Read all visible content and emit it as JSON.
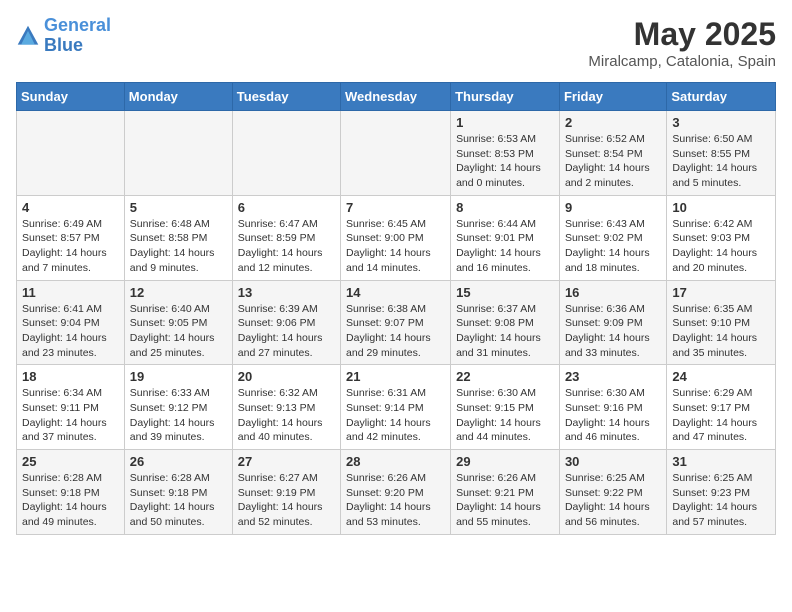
{
  "header": {
    "logo_line1": "General",
    "logo_line2": "Blue",
    "month_year": "May 2025",
    "location": "Miralcamp, Catalonia, Spain"
  },
  "days_of_week": [
    "Sunday",
    "Monday",
    "Tuesday",
    "Wednesday",
    "Thursday",
    "Friday",
    "Saturday"
  ],
  "weeks": [
    [
      {
        "day": "",
        "info": ""
      },
      {
        "day": "",
        "info": ""
      },
      {
        "day": "",
        "info": ""
      },
      {
        "day": "",
        "info": ""
      },
      {
        "day": "1",
        "info": "Sunrise: 6:53 AM\nSunset: 8:53 PM\nDaylight: 14 hours and 0 minutes."
      },
      {
        "day": "2",
        "info": "Sunrise: 6:52 AM\nSunset: 8:54 PM\nDaylight: 14 hours and 2 minutes."
      },
      {
        "day": "3",
        "info": "Sunrise: 6:50 AM\nSunset: 8:55 PM\nDaylight: 14 hours and 5 minutes."
      }
    ],
    [
      {
        "day": "4",
        "info": "Sunrise: 6:49 AM\nSunset: 8:57 PM\nDaylight: 14 hours and 7 minutes."
      },
      {
        "day": "5",
        "info": "Sunrise: 6:48 AM\nSunset: 8:58 PM\nDaylight: 14 hours and 9 minutes."
      },
      {
        "day": "6",
        "info": "Sunrise: 6:47 AM\nSunset: 8:59 PM\nDaylight: 14 hours and 12 minutes."
      },
      {
        "day": "7",
        "info": "Sunrise: 6:45 AM\nSunset: 9:00 PM\nDaylight: 14 hours and 14 minutes."
      },
      {
        "day": "8",
        "info": "Sunrise: 6:44 AM\nSunset: 9:01 PM\nDaylight: 14 hours and 16 minutes."
      },
      {
        "day": "9",
        "info": "Sunrise: 6:43 AM\nSunset: 9:02 PM\nDaylight: 14 hours and 18 minutes."
      },
      {
        "day": "10",
        "info": "Sunrise: 6:42 AM\nSunset: 9:03 PM\nDaylight: 14 hours and 20 minutes."
      }
    ],
    [
      {
        "day": "11",
        "info": "Sunrise: 6:41 AM\nSunset: 9:04 PM\nDaylight: 14 hours and 23 minutes."
      },
      {
        "day": "12",
        "info": "Sunrise: 6:40 AM\nSunset: 9:05 PM\nDaylight: 14 hours and 25 minutes."
      },
      {
        "day": "13",
        "info": "Sunrise: 6:39 AM\nSunset: 9:06 PM\nDaylight: 14 hours and 27 minutes."
      },
      {
        "day": "14",
        "info": "Sunrise: 6:38 AM\nSunset: 9:07 PM\nDaylight: 14 hours and 29 minutes."
      },
      {
        "day": "15",
        "info": "Sunrise: 6:37 AM\nSunset: 9:08 PM\nDaylight: 14 hours and 31 minutes."
      },
      {
        "day": "16",
        "info": "Sunrise: 6:36 AM\nSunset: 9:09 PM\nDaylight: 14 hours and 33 minutes."
      },
      {
        "day": "17",
        "info": "Sunrise: 6:35 AM\nSunset: 9:10 PM\nDaylight: 14 hours and 35 minutes."
      }
    ],
    [
      {
        "day": "18",
        "info": "Sunrise: 6:34 AM\nSunset: 9:11 PM\nDaylight: 14 hours and 37 minutes."
      },
      {
        "day": "19",
        "info": "Sunrise: 6:33 AM\nSunset: 9:12 PM\nDaylight: 14 hours and 39 minutes."
      },
      {
        "day": "20",
        "info": "Sunrise: 6:32 AM\nSunset: 9:13 PM\nDaylight: 14 hours and 40 minutes."
      },
      {
        "day": "21",
        "info": "Sunrise: 6:31 AM\nSunset: 9:14 PM\nDaylight: 14 hours and 42 minutes."
      },
      {
        "day": "22",
        "info": "Sunrise: 6:30 AM\nSunset: 9:15 PM\nDaylight: 14 hours and 44 minutes."
      },
      {
        "day": "23",
        "info": "Sunrise: 6:30 AM\nSunset: 9:16 PM\nDaylight: 14 hours and 46 minutes."
      },
      {
        "day": "24",
        "info": "Sunrise: 6:29 AM\nSunset: 9:17 PM\nDaylight: 14 hours and 47 minutes."
      }
    ],
    [
      {
        "day": "25",
        "info": "Sunrise: 6:28 AM\nSunset: 9:18 PM\nDaylight: 14 hours and 49 minutes."
      },
      {
        "day": "26",
        "info": "Sunrise: 6:28 AM\nSunset: 9:18 PM\nDaylight: 14 hours and 50 minutes."
      },
      {
        "day": "27",
        "info": "Sunrise: 6:27 AM\nSunset: 9:19 PM\nDaylight: 14 hours and 52 minutes."
      },
      {
        "day": "28",
        "info": "Sunrise: 6:26 AM\nSunset: 9:20 PM\nDaylight: 14 hours and 53 minutes."
      },
      {
        "day": "29",
        "info": "Sunrise: 6:26 AM\nSunset: 9:21 PM\nDaylight: 14 hours and 55 minutes."
      },
      {
        "day": "30",
        "info": "Sunrise: 6:25 AM\nSunset: 9:22 PM\nDaylight: 14 hours and 56 minutes."
      },
      {
        "day": "31",
        "info": "Sunrise: 6:25 AM\nSunset: 9:23 PM\nDaylight: 14 hours and 57 minutes."
      }
    ]
  ]
}
